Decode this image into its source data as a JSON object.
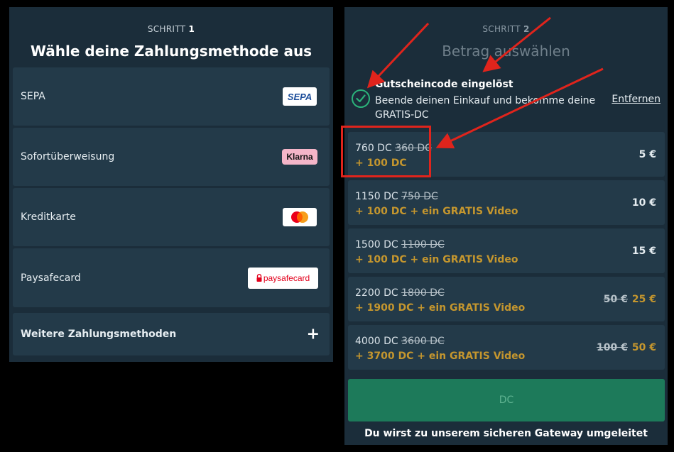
{
  "left": {
    "step_prefix": "SCHRITT",
    "step_num": "1",
    "title": "Wähle deine Zahlungsmethode aus",
    "methods": [
      {
        "label": "SEPA",
        "logo_text": "SEPA",
        "icon": "sepa-logo"
      },
      {
        "label": "Sofortüberweisung",
        "logo_text": "Klarna",
        "icon": "klarna-logo"
      },
      {
        "label": "Kreditkarte",
        "icon": "mastercard-logo"
      },
      {
        "label": "Paysafecard",
        "logo_text": "paysafecard",
        "icon": "paysafecard-logo"
      }
    ],
    "more_label": "Weitere Zahlungsmethoden",
    "more_icon": "+"
  },
  "right": {
    "step_prefix": "SCHRITT",
    "step_num": "2",
    "title": "Betrag auswählen",
    "voucher": {
      "title": "Gutscheincode eingelöst",
      "desc": "Beende deinen Einkauf und bekomme deine GRATIS-DC",
      "remove": "Entfernen"
    },
    "amounts": [
      {
        "dc": "760 DC",
        "old_dc": "360 DC",
        "bonus": "+ 100 DC",
        "old_price": "",
        "price": "5 €"
      },
      {
        "dc": "1150 DC",
        "old_dc": "750 DC",
        "bonus": "+ 100 DC + ein GRATIS Video",
        "old_price": "",
        "price": "10 €"
      },
      {
        "dc": "1500 DC",
        "old_dc": "1100 DC",
        "bonus": "+ 100 DC + ein GRATIS Video",
        "old_price": "",
        "price": "15 €"
      },
      {
        "dc": "2200 DC",
        "old_dc": "1800 DC",
        "bonus": "+ 1900 DC + ein GRATIS Video",
        "old_price": "50 €",
        "price": "25 €"
      },
      {
        "dc": "4000 DC",
        "old_dc": "3600 DC",
        "bonus": "+ 3700 DC + ein GRATIS Video",
        "old_price": "100 €",
        "price": "50 €"
      }
    ],
    "cta": "DC",
    "gateway": "Du wirst zu unserem sicheren Gateway umgeleitet"
  },
  "colors": {
    "accent_green": "#1d7a5a",
    "gold": "#c4962e",
    "annotation_red": "#e0241c"
  }
}
